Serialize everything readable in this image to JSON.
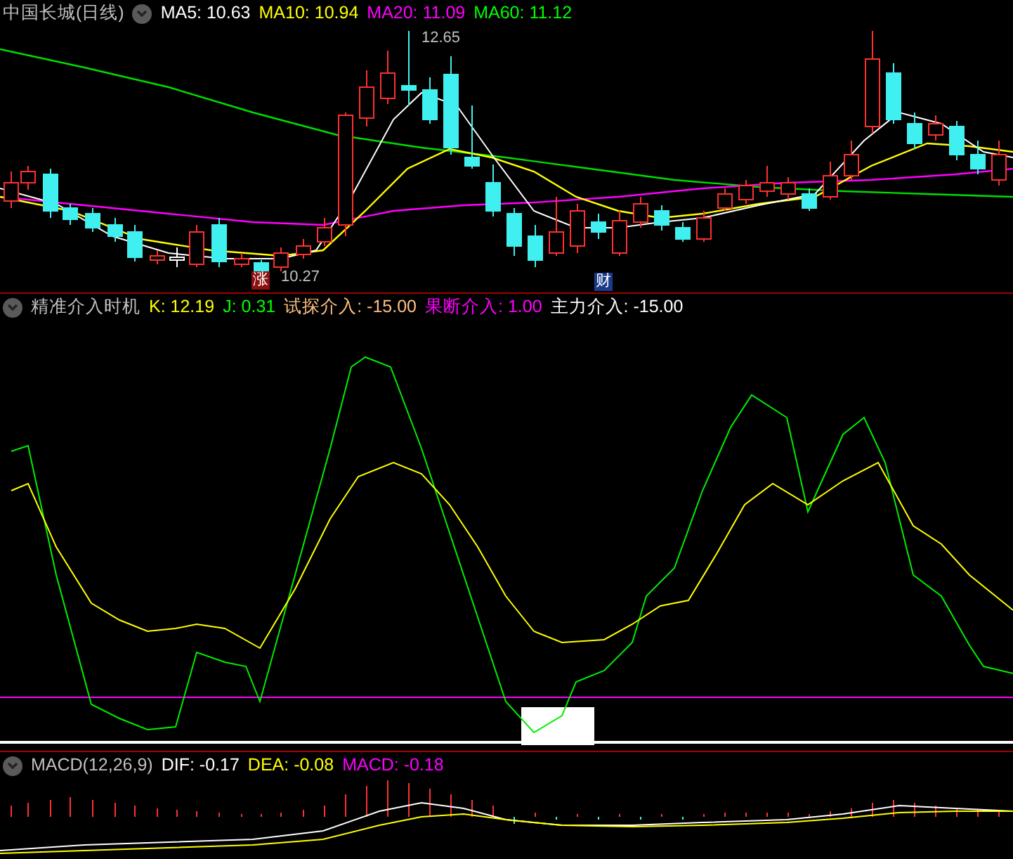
{
  "main_chart": {
    "title": "中国长城(日线)",
    "indicators": [
      {
        "label": "MA5: 10.63",
        "color": "#ffffff"
      },
      {
        "label": "MA10: 10.94",
        "color": "#ffff00"
      },
      {
        "label": "MA20: 11.09",
        "color": "#ff00ff"
      },
      {
        "label": "MA60: 11.12",
        "color": "#00ff00"
      }
    ],
    "price_labels": [
      {
        "text": "12.65",
        "kind": "high"
      },
      {
        "text": "10.27",
        "kind": "low"
      }
    ],
    "event_markers": [
      {
        "text": "涨",
        "color": "#8b1010"
      },
      {
        "text": "财",
        "color": "#1a3a8a"
      }
    ]
  },
  "timing_panel": {
    "title": "精准介入时机",
    "indicators": [
      {
        "label": "K: 12.19",
        "color": "#ffff00"
      },
      {
        "label": "J: 0.31",
        "color": "#00ff00"
      },
      {
        "label": "试探介入: -15.00",
        "color": "#ffc080"
      },
      {
        "label": "果断介入: 1.00",
        "color": "#ff00ff"
      },
      {
        "label": "主力介入: -15.00",
        "color": "#ffffff"
      }
    ]
  },
  "macd_panel": {
    "title": "MACD(12,26,9)",
    "indicators": [
      {
        "label": "DIF: -0.17",
        "color": "#ffffff"
      },
      {
        "label": "DEA: -0.08",
        "color": "#ffff00"
      },
      {
        "label": "MACD: -0.18",
        "color": "#ff00ff"
      }
    ]
  }
}
